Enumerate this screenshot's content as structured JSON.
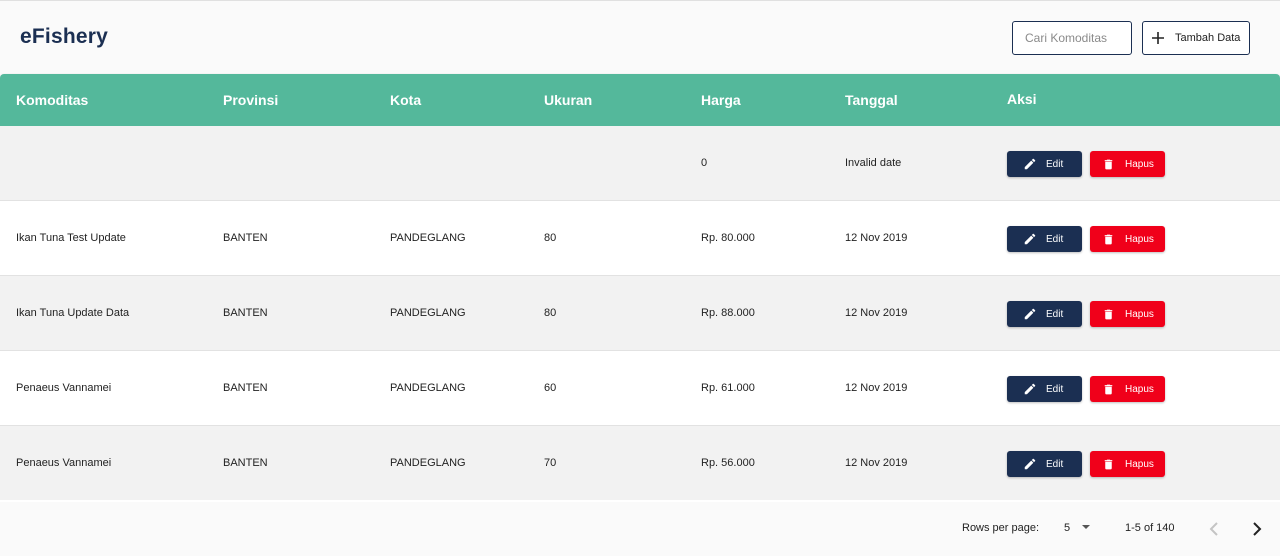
{
  "app": {
    "brand": "eFishery"
  },
  "toolbar": {
    "search_placeholder": "Cari Komoditas",
    "search_value": "",
    "add_label": "Tambah Data"
  },
  "table": {
    "columns": [
      "Komoditas",
      "Provinsi",
      "Kota",
      "Ukuran",
      "Harga",
      "Tanggal",
      "Aksi"
    ],
    "edit_label": "Edit",
    "delete_label": "Hapus",
    "rows": [
      {
        "komoditas": "",
        "provinsi": "",
        "kota": "",
        "ukuran": "",
        "harga": "0",
        "tanggal": "Invalid date"
      },
      {
        "komoditas": "Ikan Tuna Test Update",
        "provinsi": "BANTEN",
        "kota": "PANDEGLANG",
        "ukuran": "80",
        "harga": "Rp. 80.000",
        "tanggal": "12 Nov 2019"
      },
      {
        "komoditas": "Ikan Tuna Update Data",
        "provinsi": "BANTEN",
        "kota": "PANDEGLANG",
        "ukuran": "80",
        "harga": "Rp. 88.000",
        "tanggal": "12 Nov 2019"
      },
      {
        "komoditas": "Penaeus Vannamei",
        "provinsi": "BANTEN",
        "kota": "PANDEGLANG",
        "ukuran": "60",
        "harga": "Rp. 61.000",
        "tanggal": "12 Nov 2019"
      },
      {
        "komoditas": "Penaeus Vannamei",
        "provinsi": "BANTEN",
        "kota": "PANDEGLANG",
        "ukuran": "70",
        "harga": "Rp. 56.000",
        "tanggal": "12 Nov 2019"
      }
    ]
  },
  "pagination": {
    "rows_per_page_label": "Rows per page:",
    "rows_per_page_value": "5",
    "range_label": "1-5 of 140"
  },
  "colors": {
    "header_bg": "#54b89b",
    "primary": "#1b2f52",
    "danger": "#f0001a"
  },
  "icons": {
    "add": "plus-icon",
    "edit": "pencil-icon",
    "delete": "trash-icon",
    "dropdown": "caret-down-icon",
    "prev": "chevron-left-icon",
    "next": "chevron-right-icon"
  }
}
